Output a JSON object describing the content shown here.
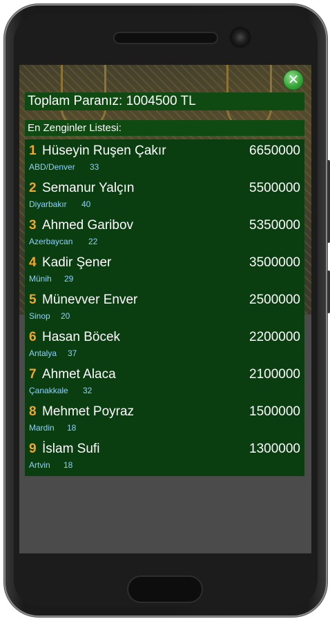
{
  "total": {
    "label": "Toplam Paranız: 1004500 TL"
  },
  "list_title": "En Zenginler Listesi:",
  "close_icon": "close-icon",
  "colors": {
    "panel": "#0a3d10",
    "rank": "#f5a623",
    "subtext": "#8fd1ff"
  },
  "rows": [
    {
      "rank": "1",
      "name": "Hüseyin Ruşen Çakır",
      "amount": "6650000",
      "city": "ABD/Denver",
      "age": "33"
    },
    {
      "rank": "2",
      "name": "Semanur Yalçın",
      "amount": "5500000",
      "city": "Diyarbakır",
      "age": "40"
    },
    {
      "rank": "3",
      "name": "Ahmed Garibov",
      "amount": "5350000",
      "city": "Azerbaycan",
      "age": "22"
    },
    {
      "rank": "4",
      "name": "Kadir Şener",
      "amount": "3500000",
      "city": "Münih",
      "age": "29"
    },
    {
      "rank": "5",
      "name": "Münevver Enver",
      "amount": "2500000",
      "city": "Sinop",
      "age": "20"
    },
    {
      "rank": "6",
      "name": "Hasan Böcek",
      "amount": "2200000",
      "city": "Antalya",
      "age": "37"
    },
    {
      "rank": "7",
      "name": "Ahmet Alaca",
      "amount": "2100000",
      "city": "Çanakkale",
      "age": "32"
    },
    {
      "rank": "8",
      "name": "Mehmet Poyraz",
      "amount": "1500000",
      "city": "Mardin",
      "age": "18"
    },
    {
      "rank": "9",
      "name": "İslam Sufi",
      "amount": "1300000",
      "city": "Artvin",
      "age": "18"
    }
  ]
}
